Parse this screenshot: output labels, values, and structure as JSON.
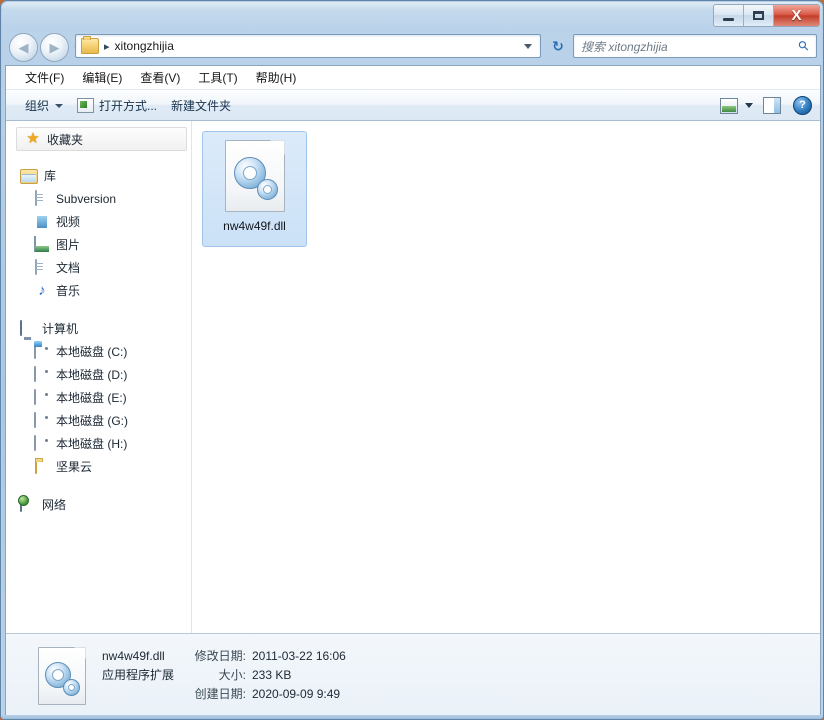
{
  "window": {
    "caption_buttons": [
      {
        "name": "minimize",
        "glyph": "minimize-icon"
      },
      {
        "name": "maximize",
        "glyph": "maximize-icon"
      },
      {
        "name": "close",
        "glyph": "X"
      }
    ]
  },
  "navigation": {
    "back_label": "◀",
    "forward_label": "▶",
    "recent_pages_label": "▾",
    "address": {
      "separator": "▸",
      "path_text": "xitongzhijia",
      "dropdown_label": "▾"
    },
    "refresh_label": "↻",
    "search": {
      "placeholder": "搜索 xitongzhijia",
      "icon_label": "⚲"
    }
  },
  "menubar": {
    "items": [
      {
        "label": "文件(F)"
      },
      {
        "label": "编辑(E)"
      },
      {
        "label": "查看(V)"
      },
      {
        "label": "工具(T)"
      },
      {
        "label": "帮助(H)"
      }
    ]
  },
  "toolbar": {
    "organize_label": "组织",
    "open_with_label": "打开方式...",
    "new_folder_label": "新建文件夹",
    "help_glyph": "?"
  },
  "sidebar": {
    "favorites": {
      "label": "收藏夹"
    },
    "libraries": {
      "label": "库",
      "items": [
        {
          "label": "Subversion",
          "icon": "subversion-icon"
        },
        {
          "label": "视频",
          "icon": "video-icon"
        },
        {
          "label": "图片",
          "icon": "pictures-icon"
        },
        {
          "label": "文档",
          "icon": "documents-icon"
        },
        {
          "label": "音乐",
          "icon": "music-icon"
        }
      ]
    },
    "computer": {
      "label": "计算机",
      "items": [
        {
          "label": "本地磁盘 (C:)",
          "icon": "system-drive-icon"
        },
        {
          "label": "本地磁盘 (D:)",
          "icon": "drive-icon"
        },
        {
          "label": "本地磁盘 (E:)",
          "icon": "drive-icon"
        },
        {
          "label": "本地磁盘 (G:)",
          "icon": "drive-icon"
        },
        {
          "label": "本地磁盘 (H:)",
          "icon": "drive-icon"
        },
        {
          "label": "坚果云",
          "icon": "folder-icon"
        }
      ]
    },
    "network": {
      "label": "网络"
    }
  },
  "files": {
    "items": [
      {
        "name": "nw4w49f.dll",
        "icon": "dll-gear-icon",
        "selected": true
      }
    ]
  },
  "details": {
    "file_name": "nw4w49f.dll",
    "file_type": "应用程序扩展",
    "modified_key": "修改日期:",
    "modified_value": "2011-03-22 16:06",
    "size_key": "大小:",
    "size_value": "233 KB",
    "created_key": "创建日期:",
    "created_value": "2020-09-09 9:49"
  },
  "music_glyph": "♪"
}
